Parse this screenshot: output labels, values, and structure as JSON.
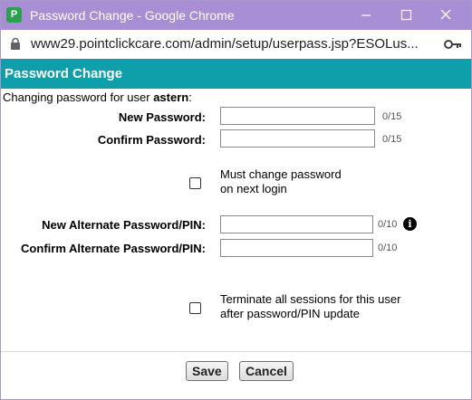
{
  "window": {
    "title": "Password Change - Google Chrome",
    "app_icon_glyph": "P",
    "accent_color": "#a88ed4"
  },
  "address_bar": {
    "url": "www29.pointclickcare.com/admin/setup/userpass.jsp?ESOLus...",
    "icons": [
      "lock-icon",
      "key-icon"
    ]
  },
  "dialog": {
    "title": "Password Change",
    "header_color": "#0e9fab",
    "intro_prefix": "Changing password for user ",
    "username": "astern",
    "intro_suffix": ":"
  },
  "form": {
    "new_password": {
      "label": "New Password:",
      "value": "",
      "counter": "0/15"
    },
    "confirm_password": {
      "label": "Confirm Password:",
      "value": "",
      "counter": "0/15"
    },
    "must_change": {
      "line1": "Must change password",
      "line2": "on next login",
      "checked": false
    },
    "new_alt_password": {
      "label": "New Alternate Password/PIN:",
      "value": "",
      "counter": "0/10"
    },
    "confirm_alt_password": {
      "label": "Confirm Alternate Password/PIN:",
      "value": "",
      "counter": "0/10"
    },
    "terminate_sessions": {
      "line1": "Terminate all sessions for this user",
      "line2": "after password/PIN update",
      "checked": false
    }
  },
  "buttons": {
    "save": "Save",
    "cancel": "Cancel"
  }
}
